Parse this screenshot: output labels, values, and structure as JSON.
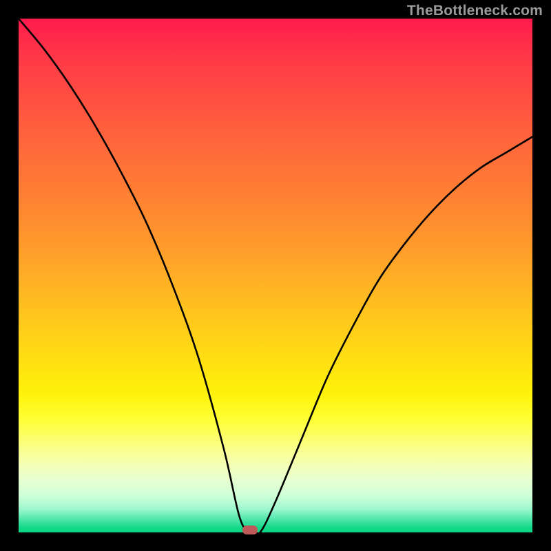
{
  "watermark": "TheBottleneck.com",
  "colors": {
    "background": "#000000",
    "curve": "#000000",
    "marker": "#bf5a5a",
    "watermark_text": "#9a9a9a"
  },
  "chart_data": {
    "type": "line",
    "title": "",
    "xlabel": "",
    "ylabel": "",
    "xlim": [
      0,
      100
    ],
    "ylim": [
      0,
      100
    ],
    "grid": false,
    "legend": false,
    "background_gradient": {
      "top_color": "#ff1a4d",
      "bottom_color": "#0ad684",
      "description": "red-to-green vertical gradient (red=high bottleneck, green=low)"
    },
    "series": [
      {
        "name": "bottleneck_curve",
        "description": "V-shaped bottleneck curve; y≈100 (bad) at edges, dipping to y≈0 (good) near x≈45",
        "x": [
          0,
          5,
          10,
          15,
          20,
          25,
          30,
          35,
          40,
          43,
          45,
          47,
          50,
          55,
          60,
          65,
          70,
          75,
          80,
          85,
          90,
          95,
          100
        ],
        "y": [
          100,
          94,
          87,
          79,
          70,
          60,
          48,
          34,
          16,
          3,
          0,
          0,
          6,
          18,
          30,
          40,
          49,
          56,
          62,
          67,
          71,
          74,
          77
        ]
      }
    ],
    "marker": {
      "x": 45,
      "y": 0,
      "shape": "rounded-rect",
      "color": "#bf5a5a",
      "description": "optimal (zero-bottleneck) point"
    }
  }
}
